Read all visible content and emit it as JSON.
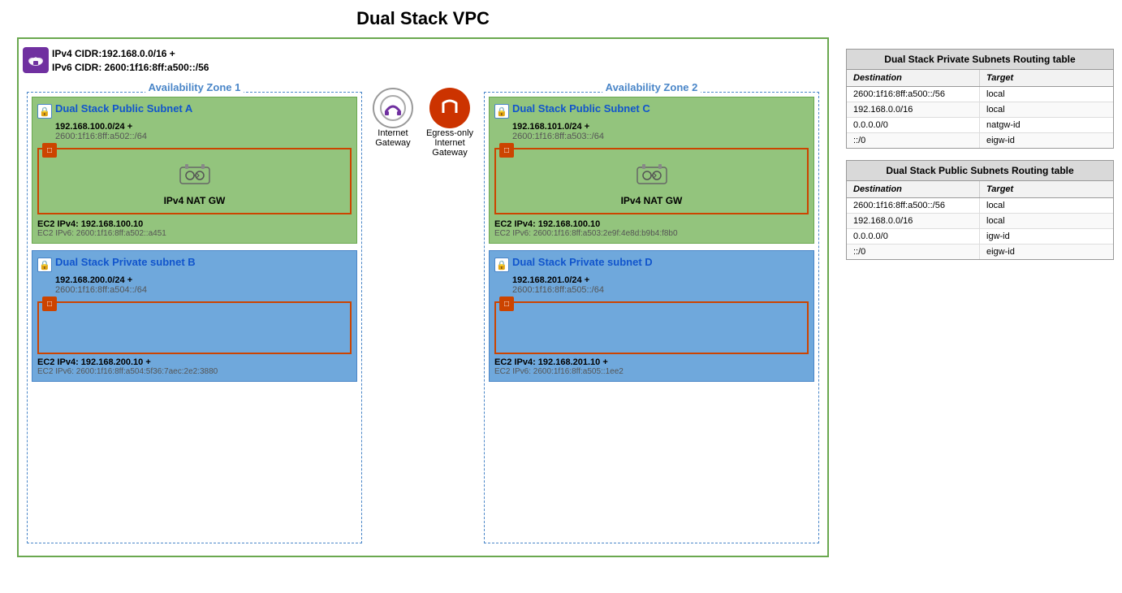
{
  "title": "Dual Stack VPC",
  "vpc": {
    "ipv4_cidr": "IPv4 CIDR:192.168.0.0/16 +",
    "ipv6_cidr": "IPv6 CIDR: 2600:1f16:8ff:a500::/56"
  },
  "az1": {
    "label": "Availability Zone 1",
    "public_subnet": {
      "name": "Dual Stack Public Subnet A",
      "ipv4": "192.168.100.0/24 +",
      "ipv6": "2600:1f16:8ff:a502::/64",
      "nat_gw_label": "IPv4 NAT GW",
      "ec2_ipv4": "EC2 IPv4: 192.168.100.10",
      "ec2_ipv6": "EC2 IPv6: 2600:1f16:8ff:a502::a451"
    },
    "private_subnet": {
      "name": "Dual Stack Private subnet B",
      "ipv4": "192.168.200.0/24 +",
      "ipv6": "2600:1f16:8ff:a504::/64",
      "ec2_ipv4": "EC2 IPv4: 192.168.200.10 +",
      "ec2_ipv6": "EC2 IPv6: 2600:1f16:8ff:a504:5f36:7aec:2e2:3880"
    }
  },
  "az2": {
    "label": "Availability Zone 2",
    "public_subnet": {
      "name": "Dual Stack Public Subnet C",
      "ipv4": "192.168.101.0/24 +",
      "ipv6": "2600:1f16:8ff:a503::/64",
      "nat_gw_label": "IPv4 NAT GW",
      "ec2_ipv4": "EC2 IPv4: 192.168.100.10",
      "ec2_ipv6": "EC2 IPv6: 2600:1f16:8ff:a503:2e9f:4e8d:b9b4:f8b0"
    },
    "private_subnet": {
      "name": "Dual Stack Private subnet D",
      "ipv4": "192.168.201.0/24 +",
      "ipv6": "2600:1f16:8ff:a505::/64",
      "ec2_ipv4": "EC2 IPv4: 192.168.201.10 +",
      "ec2_ipv6": "EC2 IPv6: 2600:1f16:8ff:a505::1ee2"
    }
  },
  "gateways": {
    "igw_label_line1": "Internet",
    "igw_label_line2": "Gateway",
    "eigw_label_line1": "Egress-only",
    "eigw_label_line2": "Internet",
    "eigw_label_line3": "Gateway"
  },
  "private_routing_table": {
    "title": "Dual Stack Private Subnets Routing table",
    "col1": "Destination",
    "col2": "Target",
    "rows": [
      {
        "dest": "2600:1f16:8ff:a500::/56",
        "target": "local"
      },
      {
        "dest": "192.168.0.0/16",
        "target": "local"
      },
      {
        "dest": "0.0.0.0/0",
        "target": "natgw-id"
      },
      {
        "dest": "::/0",
        "target": "eigw-id"
      }
    ]
  },
  "public_routing_table": {
    "title": "Dual Stack Public Subnets Routing table",
    "col1": "Destination",
    "col2": "Target",
    "rows": [
      {
        "dest": "2600:1f16:8ff:a500::/56",
        "target": "local"
      },
      {
        "dest": "192.168.0.0/16",
        "target": "local"
      },
      {
        "dest": "0.0.0.0/0",
        "target": "igw-id"
      },
      {
        "dest": "::/0",
        "target": "eigw-id"
      }
    ]
  }
}
